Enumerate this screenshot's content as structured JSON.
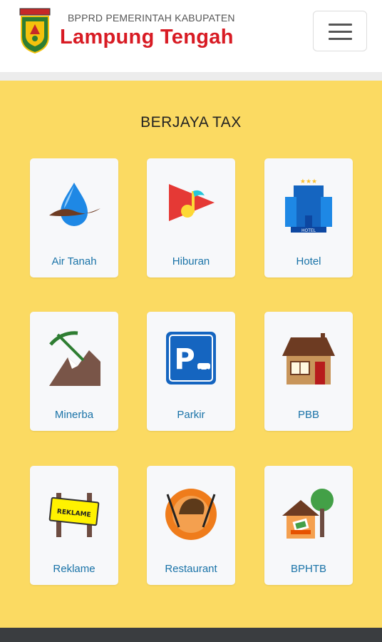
{
  "header": {
    "org": "BPPRD PEMERINTAH KABUPATEN",
    "city": "Lampung Tengah",
    "logo_icon": "regency-crest-icon",
    "menu_icon": "hamburger-menu-icon"
  },
  "main": {
    "title": "BERJAYA TAX",
    "items": [
      {
        "label": "Air Tanah",
        "icon": "water-drop-icon"
      },
      {
        "label": "Hiburan",
        "icon": "music-play-icon"
      },
      {
        "label": "Hotel",
        "icon": "hotel-building-icon",
        "icon_text": "HOTEL"
      },
      {
        "label": "Minerba",
        "icon": "mining-pickaxe-icon"
      },
      {
        "label": "Parkir",
        "icon": "parking-sign-icon"
      },
      {
        "label": "PBB",
        "icon": "house-icon"
      },
      {
        "label": "Reklame",
        "icon": "billboard-icon",
        "icon_text": "REKLAME"
      },
      {
        "label": "Restaurant",
        "icon": "restaurant-plate-icon"
      },
      {
        "label": "BPHTB",
        "icon": "house-tree-icon"
      }
    ]
  },
  "colors": {
    "background": "#fbda62",
    "city_title": "#d81b24",
    "label": "#1a73a8",
    "card": "#f7f8fa"
  }
}
